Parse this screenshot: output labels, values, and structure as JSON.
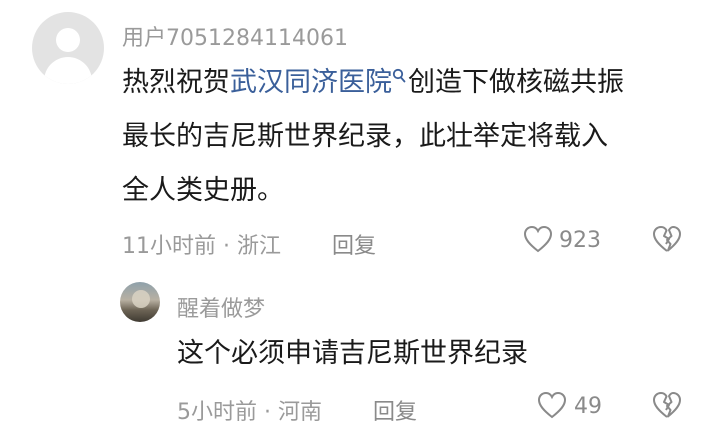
{
  "comment": {
    "username": "用户7051284114061",
    "text_lines": [
      {
        "prefix": "热烈祝贺",
        "link": "武汉同济医院",
        "suffix": "创造下做核磁共振"
      },
      "最长的吉尼斯世界纪录，此壮举定将载入",
      "全人类史册。"
    ],
    "time_location": "11小时前 · 浙江",
    "reply_label": "回复",
    "like_count": "923"
  },
  "reply": {
    "username": "醒着做梦",
    "text": "这个必须申请吉尼斯世界纪录",
    "time_location": "5小时前 · 河南",
    "reply_label": "回复",
    "like_count": "49"
  },
  "colors": {
    "link": "#3a5f9a",
    "meta": "#9a9a9a",
    "text": "#1a1a1a"
  }
}
